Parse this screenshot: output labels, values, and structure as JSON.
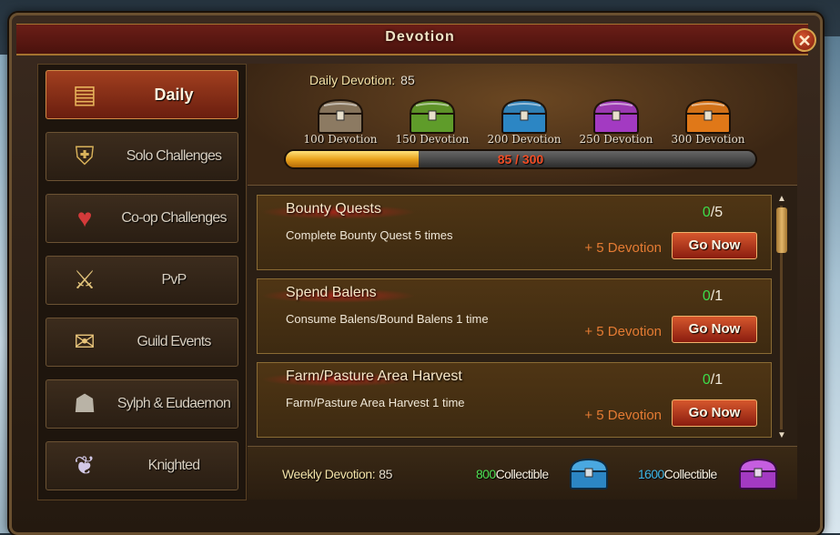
{
  "title": "Devotion",
  "close_label": "✕",
  "sidebar": [
    {
      "label": "Daily",
      "icon": "chest-icon",
      "glyph": "▤",
      "active": true
    },
    {
      "label": "Solo Challenges",
      "icon": "shield-icon",
      "glyph": "⛨"
    },
    {
      "label": "Co-op Challenges",
      "icon": "heart-icon",
      "glyph": "♥"
    },
    {
      "label": "PvP",
      "icon": "crossed-swords-icon",
      "glyph": "⚔"
    },
    {
      "label": "Guild Events",
      "icon": "scroll-icon",
      "glyph": "✉"
    },
    {
      "label": "Sylph & Eudaemon",
      "icon": "helmet-icon",
      "glyph": "☗"
    },
    {
      "label": "Knighted",
      "icon": "wings-emblem-icon",
      "glyph": "❦"
    }
  ],
  "daily": {
    "label": "Daily Devotion:",
    "value": "85"
  },
  "milestones": [
    {
      "label": "100 Devotion",
      "icon": "bronze-chest-icon",
      "color": "#8c7a62"
    },
    {
      "label": "150 Devotion",
      "icon": "green-chest-icon",
      "color": "#5f9c2a"
    },
    {
      "label": "200 Devotion",
      "icon": "blue-chest-icon",
      "color": "#2c86c4"
    },
    {
      "label": "250 Devotion",
      "icon": "purple-chest-icon",
      "color": "#a33ac2"
    },
    {
      "label": "300 Devotion",
      "icon": "orange-chest-icon",
      "color": "#e07818"
    }
  ],
  "progress": {
    "current": 85,
    "max": 300,
    "text": "85 / 300"
  },
  "tasks": [
    {
      "name": "Bounty Quests",
      "desc": "Complete Bounty Quest 5 times",
      "done": "0",
      "total": "/5",
      "reward": "+ 5 Devotion",
      "button": "Go Now"
    },
    {
      "name": "Spend Balens",
      "desc": "Consume Balens/Bound Balens 1 time",
      "done": "0",
      "total": "/1",
      "reward": "+ 5 Devotion",
      "button": "Go Now"
    },
    {
      "name": "Farm/Pasture Area Harvest",
      "desc": "Farm/Pasture Area Harvest 1 time",
      "done": "0",
      "total": "/1",
      "reward": "+ 5 Devotion",
      "button": "Go Now"
    }
  ],
  "scroll": {
    "up": "▲",
    "down": "▼"
  },
  "weekly": {
    "label": "Weekly Devotion:",
    "value": "85"
  },
  "collectibles": [
    {
      "amount": "800",
      "label": "Collectible",
      "icon": "blue-chest-icon",
      "color": "#2c86c4"
    },
    {
      "amount": "1600",
      "label": "Collectible",
      "icon": "purple-chest-icon",
      "color": "#a33ac2"
    }
  ],
  "colors": {
    "accent_red": "#a13f1f",
    "gold": "#d6a44c",
    "progress_text": "#f14d26",
    "green": "#4fdf54",
    "cyan": "#3fb6e6"
  }
}
